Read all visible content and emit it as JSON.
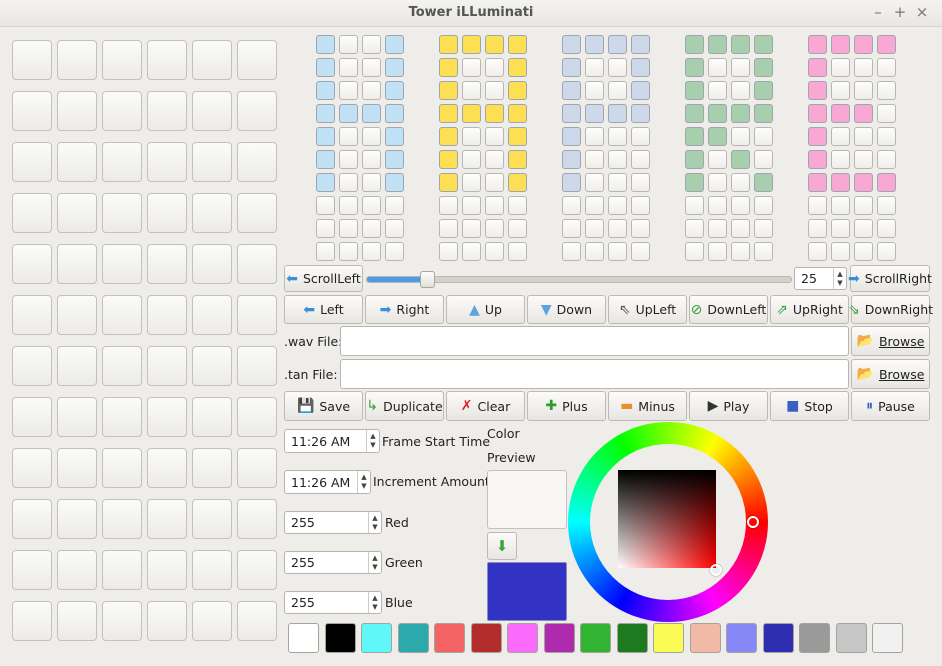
{
  "window": {
    "title": "Tower iLLuminati",
    "controls": [
      "–",
      "+",
      "×"
    ]
  },
  "banks": [
    {
      "name": "blue",
      "color": "#bfe0f5",
      "rows": [
        [
          1,
          0,
          0,
          1
        ],
        [
          1,
          0,
          0,
          1
        ],
        [
          1,
          0,
          0,
          1
        ],
        [
          1,
          1,
          1,
          1
        ],
        [
          1,
          0,
          0,
          1
        ],
        [
          1,
          0,
          0,
          1
        ],
        [
          1,
          0,
          0,
          1
        ],
        [
          0,
          0,
          0,
          0
        ],
        [
          0,
          0,
          0,
          0
        ],
        [
          0,
          0,
          0,
          0
        ]
      ]
    },
    {
      "name": "yellow",
      "color": "#fcdf52",
      "rows": [
        [
          1,
          1,
          1,
          1
        ],
        [
          1,
          0,
          0,
          1
        ],
        [
          1,
          0,
          0,
          1
        ],
        [
          1,
          1,
          1,
          1
        ],
        [
          1,
          0,
          0,
          1
        ],
        [
          1,
          0,
          0,
          1
        ],
        [
          1,
          0,
          0,
          1
        ],
        [
          0,
          0,
          0,
          0
        ],
        [
          0,
          0,
          0,
          0
        ],
        [
          0,
          0,
          0,
          0
        ]
      ]
    },
    {
      "name": "steel",
      "color": "#cdd8ea",
      "rows": [
        [
          1,
          1,
          1,
          1
        ],
        [
          1,
          0,
          0,
          1
        ],
        [
          1,
          0,
          0,
          1
        ],
        [
          1,
          1,
          1,
          1
        ],
        [
          1,
          0,
          0,
          0
        ],
        [
          1,
          0,
          0,
          0
        ],
        [
          1,
          0,
          0,
          0
        ],
        [
          0,
          0,
          0,
          0
        ],
        [
          0,
          0,
          0,
          0
        ],
        [
          0,
          0,
          0,
          0
        ]
      ]
    },
    {
      "name": "green",
      "color": "#a7cfae",
      "rows": [
        [
          1,
          1,
          1,
          1
        ],
        [
          1,
          0,
          0,
          1
        ],
        [
          1,
          0,
          0,
          1
        ],
        [
          1,
          1,
          1,
          1
        ],
        [
          1,
          1,
          0,
          0
        ],
        [
          1,
          0,
          1,
          0
        ],
        [
          1,
          0,
          0,
          1
        ],
        [
          0,
          0,
          0,
          0
        ],
        [
          0,
          0,
          0,
          0
        ],
        [
          0,
          0,
          0,
          0
        ]
      ]
    },
    {
      "name": "pink",
      "color": "#f8a8d2",
      "rows": [
        [
          1,
          1,
          1,
          1
        ],
        [
          1,
          0,
          0,
          0
        ],
        [
          1,
          0,
          0,
          0
        ],
        [
          1,
          1,
          1,
          0
        ],
        [
          1,
          0,
          0,
          0
        ],
        [
          1,
          0,
          0,
          0
        ],
        [
          1,
          1,
          1,
          1
        ],
        [
          0,
          0,
          0,
          0
        ],
        [
          0,
          0,
          0,
          0
        ],
        [
          0,
          0,
          0,
          0
        ]
      ]
    }
  ],
  "scroll": {
    "left_label": "ScrollLeft",
    "right_label": "ScrollRight",
    "slider_fraction": 0.14,
    "value": "25"
  },
  "direction_buttons": [
    {
      "label": "Left",
      "icon": "arrow-left-icon",
      "glyph": "⬅",
      "color": "#3b8fd9"
    },
    {
      "label": "Right",
      "icon": "arrow-right-icon",
      "glyph": "➡",
      "color": "#3b8fd9"
    },
    {
      "label": "Up",
      "icon": "arrow-up-icon",
      "glyph": "▲",
      "color": "#5aa4e0"
    },
    {
      "label": "Down",
      "icon": "arrow-down-icon",
      "glyph": "▼",
      "color": "#5aa4e0"
    },
    {
      "label": "UpLeft",
      "icon": "arrow-upleft-icon",
      "glyph": "⇖",
      "color": "#555"
    },
    {
      "label": "DownLeft",
      "icon": "arrow-downleft-icon",
      "glyph": "⊘",
      "color": "#3a9a3a"
    },
    {
      "label": "UpRight",
      "icon": "arrow-upright-icon",
      "glyph": "⇗",
      "color": "#3a9a3a"
    },
    {
      "label": "DownRight",
      "icon": "arrow-downright-icon",
      "glyph": "⇘",
      "color": "#3a9a3a"
    }
  ],
  "files": {
    "wav_label": ".wav File:",
    "tan_label": ".tan File:",
    "wav_value": "",
    "tan_value": "",
    "browse_label": "Browse"
  },
  "actions": [
    {
      "label": "Save",
      "icon": "save-icon",
      "glyph": "💾",
      "color": "#3f6fb5"
    },
    {
      "label": "Duplicate",
      "icon": "duplicate-icon",
      "glyph": "↳",
      "color": "#3a9a3a"
    },
    {
      "label": "Clear",
      "icon": "clear-icon",
      "glyph": "✗",
      "color": "#d22"
    },
    {
      "label": "Plus",
      "icon": "plus-icon",
      "glyph": "✚",
      "color": "#2e9b2e"
    },
    {
      "label": "Minus",
      "icon": "minus-icon",
      "glyph": "▬",
      "color": "#e8902a"
    },
    {
      "label": "Play",
      "icon": "play-icon",
      "glyph": "▶",
      "color": "#333"
    },
    {
      "label": "Stop",
      "icon": "stop-icon",
      "glyph": "■",
      "color": "#3b5fc0"
    },
    {
      "label": "Pause",
      "icon": "pause-icon",
      "glyph": "⏸",
      "color": "#3b5fc0"
    }
  ],
  "fields": {
    "frame_start_time": {
      "value": "11:26 AM",
      "label": "Frame Start Time"
    },
    "increment_amount": {
      "value": "11:26 AM",
      "label": "Increment Amount"
    },
    "red": {
      "value": "255",
      "label": "Red"
    },
    "green": {
      "value": "255",
      "label": "Green"
    },
    "blue": {
      "value": "255",
      "label": "Blue"
    }
  },
  "color_panel": {
    "title": "Color",
    "preview_label": "Preview",
    "preview_color": "#f7f6f4",
    "apply_icon": "down-arrow-icon",
    "current_color": "#3232c4"
  },
  "palette": [
    "#ffffff",
    "#000000",
    "#5ff7f7",
    "#2ba9ab",
    "#f46464",
    "#b32c2c",
    "#fb6bfb",
    "#ae2aae",
    "#32b332",
    "#1e7a1e",
    "#fbfb56",
    "#f1b9a6",
    "#8787f7",
    "#2e2eb0",
    "#9a9a9a",
    "#c6c6c6",
    "#f1f1f1"
  ]
}
